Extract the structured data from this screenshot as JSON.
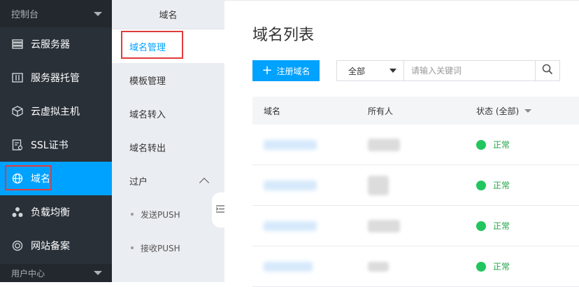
{
  "sidebar": {
    "header": "控制台",
    "items": [
      {
        "label": "云服务器",
        "icon": "server-icon"
      },
      {
        "label": "服务器托管",
        "icon": "hosting-icon"
      },
      {
        "label": "云虚拟主机",
        "icon": "cube-icon"
      },
      {
        "label": "SSL证书",
        "icon": "certificate-icon"
      },
      {
        "label": "域名",
        "icon": "globe-icon",
        "active": true
      },
      {
        "label": "负载均衡",
        "icon": "load-balance-icon"
      },
      {
        "label": "网站备案",
        "icon": "record-icon"
      }
    ],
    "footer": "用户中心"
  },
  "subnav": {
    "title": "域名",
    "items": [
      {
        "label": "域名管理",
        "active": true
      },
      {
        "label": "模板管理"
      },
      {
        "label": "域名转入"
      },
      {
        "label": "域名转出"
      }
    ],
    "group": {
      "label": "过户",
      "children": [
        "发送PUSH",
        "接收PUSH"
      ]
    }
  },
  "main": {
    "title": "域名列表",
    "register_button": "注册域名",
    "filter": {
      "selected": "全部",
      "placeholder": "请输入关键词"
    },
    "table": {
      "headers": [
        "域名",
        "所有人",
        "状态 (全部)"
      ],
      "rows": [
        {
          "status": "正常"
        },
        {
          "status": "正常"
        },
        {
          "status": "正常"
        },
        {
          "status": "正常"
        }
      ]
    }
  },
  "colors": {
    "accent": "#00a2ff",
    "sidebar_bg": "#293038",
    "status_ok": "#22c55e",
    "highlight": "#e23b3b"
  }
}
